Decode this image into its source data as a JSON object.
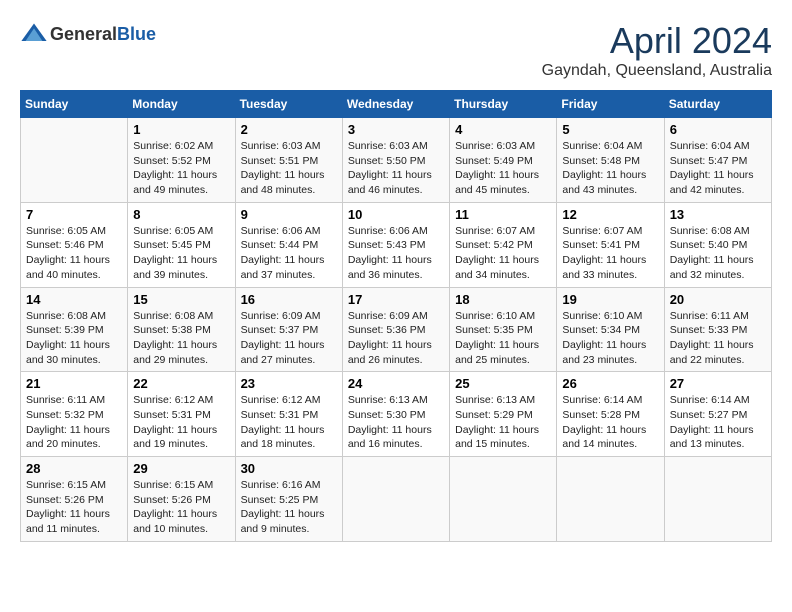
{
  "header": {
    "logo_general": "General",
    "logo_blue": "Blue",
    "month": "April 2024",
    "location": "Gayndah, Queensland, Australia"
  },
  "days_of_week": [
    "Sunday",
    "Monday",
    "Tuesday",
    "Wednesday",
    "Thursday",
    "Friday",
    "Saturday"
  ],
  "weeks": [
    [
      {
        "day": "",
        "info": ""
      },
      {
        "day": "1",
        "info": "Sunrise: 6:02 AM\nSunset: 5:52 PM\nDaylight: 11 hours\nand 49 minutes."
      },
      {
        "day": "2",
        "info": "Sunrise: 6:03 AM\nSunset: 5:51 PM\nDaylight: 11 hours\nand 48 minutes."
      },
      {
        "day": "3",
        "info": "Sunrise: 6:03 AM\nSunset: 5:50 PM\nDaylight: 11 hours\nand 46 minutes."
      },
      {
        "day": "4",
        "info": "Sunrise: 6:03 AM\nSunset: 5:49 PM\nDaylight: 11 hours\nand 45 minutes."
      },
      {
        "day": "5",
        "info": "Sunrise: 6:04 AM\nSunset: 5:48 PM\nDaylight: 11 hours\nand 43 minutes."
      },
      {
        "day": "6",
        "info": "Sunrise: 6:04 AM\nSunset: 5:47 PM\nDaylight: 11 hours\nand 42 minutes."
      }
    ],
    [
      {
        "day": "7",
        "info": "Sunrise: 6:05 AM\nSunset: 5:46 PM\nDaylight: 11 hours\nand 40 minutes."
      },
      {
        "day": "8",
        "info": "Sunrise: 6:05 AM\nSunset: 5:45 PM\nDaylight: 11 hours\nand 39 minutes."
      },
      {
        "day": "9",
        "info": "Sunrise: 6:06 AM\nSunset: 5:44 PM\nDaylight: 11 hours\nand 37 minutes."
      },
      {
        "day": "10",
        "info": "Sunrise: 6:06 AM\nSunset: 5:43 PM\nDaylight: 11 hours\nand 36 minutes."
      },
      {
        "day": "11",
        "info": "Sunrise: 6:07 AM\nSunset: 5:42 PM\nDaylight: 11 hours\nand 34 minutes."
      },
      {
        "day": "12",
        "info": "Sunrise: 6:07 AM\nSunset: 5:41 PM\nDaylight: 11 hours\nand 33 minutes."
      },
      {
        "day": "13",
        "info": "Sunrise: 6:08 AM\nSunset: 5:40 PM\nDaylight: 11 hours\nand 32 minutes."
      }
    ],
    [
      {
        "day": "14",
        "info": "Sunrise: 6:08 AM\nSunset: 5:39 PM\nDaylight: 11 hours\nand 30 minutes."
      },
      {
        "day": "15",
        "info": "Sunrise: 6:08 AM\nSunset: 5:38 PM\nDaylight: 11 hours\nand 29 minutes."
      },
      {
        "day": "16",
        "info": "Sunrise: 6:09 AM\nSunset: 5:37 PM\nDaylight: 11 hours\nand 27 minutes."
      },
      {
        "day": "17",
        "info": "Sunrise: 6:09 AM\nSunset: 5:36 PM\nDaylight: 11 hours\nand 26 minutes."
      },
      {
        "day": "18",
        "info": "Sunrise: 6:10 AM\nSunset: 5:35 PM\nDaylight: 11 hours\nand 25 minutes."
      },
      {
        "day": "19",
        "info": "Sunrise: 6:10 AM\nSunset: 5:34 PM\nDaylight: 11 hours\nand 23 minutes."
      },
      {
        "day": "20",
        "info": "Sunrise: 6:11 AM\nSunset: 5:33 PM\nDaylight: 11 hours\nand 22 minutes."
      }
    ],
    [
      {
        "day": "21",
        "info": "Sunrise: 6:11 AM\nSunset: 5:32 PM\nDaylight: 11 hours\nand 20 minutes."
      },
      {
        "day": "22",
        "info": "Sunrise: 6:12 AM\nSunset: 5:31 PM\nDaylight: 11 hours\nand 19 minutes."
      },
      {
        "day": "23",
        "info": "Sunrise: 6:12 AM\nSunset: 5:31 PM\nDaylight: 11 hours\nand 18 minutes."
      },
      {
        "day": "24",
        "info": "Sunrise: 6:13 AM\nSunset: 5:30 PM\nDaylight: 11 hours\nand 16 minutes."
      },
      {
        "day": "25",
        "info": "Sunrise: 6:13 AM\nSunset: 5:29 PM\nDaylight: 11 hours\nand 15 minutes."
      },
      {
        "day": "26",
        "info": "Sunrise: 6:14 AM\nSunset: 5:28 PM\nDaylight: 11 hours\nand 14 minutes."
      },
      {
        "day": "27",
        "info": "Sunrise: 6:14 AM\nSunset: 5:27 PM\nDaylight: 11 hours\nand 13 minutes."
      }
    ],
    [
      {
        "day": "28",
        "info": "Sunrise: 6:15 AM\nSunset: 5:26 PM\nDaylight: 11 hours\nand 11 minutes."
      },
      {
        "day": "29",
        "info": "Sunrise: 6:15 AM\nSunset: 5:26 PM\nDaylight: 11 hours\nand 10 minutes."
      },
      {
        "day": "30",
        "info": "Sunrise: 6:16 AM\nSunset: 5:25 PM\nDaylight: 11 hours\nand 9 minutes."
      },
      {
        "day": "",
        "info": ""
      },
      {
        "day": "",
        "info": ""
      },
      {
        "day": "",
        "info": ""
      },
      {
        "day": "",
        "info": ""
      }
    ]
  ]
}
